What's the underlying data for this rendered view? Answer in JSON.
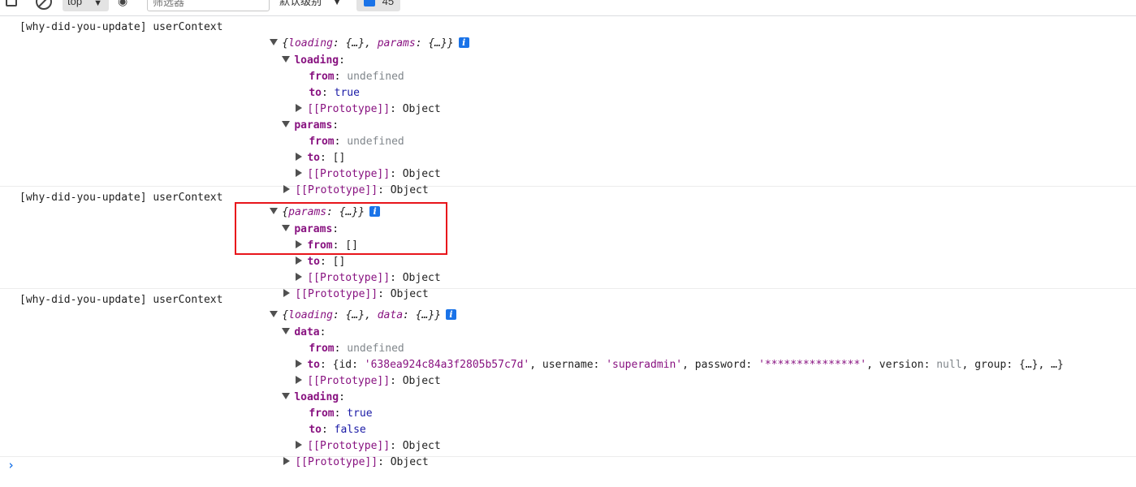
{
  "toolbar": {
    "context_label": "top",
    "filter_placeholder": "筛选器",
    "level_label": "默认级别",
    "issues_count": "45"
  },
  "messages": [
    {
      "source": "[why-did-you-update] userContext",
      "preview_open": "{",
      "preview_parts": [
        {
          "k": "loading",
          "v": "{…}"
        },
        {
          "k": "params",
          "v": "{…}"
        }
      ],
      "preview_close": "}",
      "info": "i"
    },
    {
      "source": "[why-did-you-update] userContext",
      "info": "i"
    },
    {
      "source": "[why-did-you-update] userContext",
      "info": "i"
    }
  ],
  "m1": {
    "preview": "{loading: {…}, params: {…}}",
    "loading_key": "loading",
    "from_key": "from",
    "from_val_1": "undefined",
    "to_key": "to",
    "to_val_1": "true",
    "proto": "[[Prototype]]",
    "proto_val": "Object",
    "params_key": "params",
    "from_val_2": "undefined",
    "to_val_2": "[]"
  },
  "m2": {
    "preview": "{params: {…}}",
    "params_key": "params",
    "from_key": "from",
    "from_val": "[]",
    "to_key": "to",
    "to_val": "[]",
    "proto": "[[Prototype]]",
    "proto_val": "Object"
  },
  "m3": {
    "preview": "{loading: {…}, data: {…}}",
    "data_key": "data",
    "from_key": "from",
    "from_val_1": "undefined",
    "to_key": "to",
    "obj_open": "{",
    "id_key": "id",
    "id_val": "'638ea924c84a3f2805b57c7d'",
    "username_key": "username",
    "username_val": "'superadmin'",
    "password_key": "password",
    "password_val": "'***************'",
    "version_key": "version",
    "version_val": "null",
    "group_key": "group",
    "group_val": "{…}, …}",
    "proto": "[[Prototype]]",
    "proto_val": "Object",
    "loading_key": "loading",
    "from_val_2": "true",
    "to_val_2": "false"
  },
  "prompt_symbol": "›"
}
